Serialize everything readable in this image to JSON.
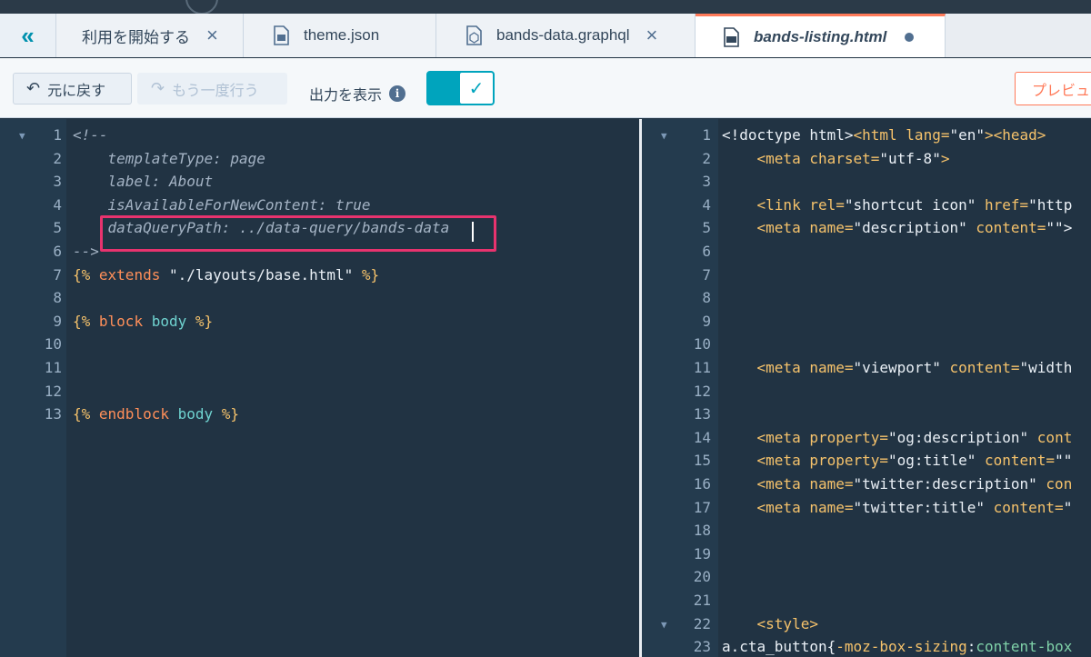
{
  "tabs": [
    {
      "label": "利用を開始する",
      "icon": "none",
      "closable": true
    },
    {
      "label": "theme.json",
      "icon": "json-file-icon",
      "closable": true
    },
    {
      "label": "bands-data.graphql",
      "icon": "graphql-file-icon",
      "closable": true
    },
    {
      "label": "bands-listing.html",
      "icon": "html-file-icon",
      "closable": false,
      "active": true,
      "unsaved": true
    }
  ],
  "toolbar": {
    "undo_label": "元に戻す",
    "redo_label": "もう一度行う",
    "output_label": "出力を表示",
    "output_toggle_on": true,
    "preview_label": "プレビュ"
  },
  "left_editor": {
    "lines": [
      {
        "n": "1",
        "fold": true,
        "parts": [
          [
            "c-com",
            "<!--"
          ]
        ]
      },
      {
        "n": "2",
        "parts": [
          [
            "c-com",
            "    templateType: page"
          ]
        ]
      },
      {
        "n": "3",
        "parts": [
          [
            "c-com",
            "    label: About"
          ]
        ]
      },
      {
        "n": "4",
        "parts": [
          [
            "c-com",
            "    isAvailableForNewContent: true"
          ]
        ]
      },
      {
        "n": "5",
        "parts": [
          [
            "c-com",
            "    dataQueryPath: ../data-query/bands-data"
          ]
        ]
      },
      {
        "n": "6",
        "parts": [
          [
            "c-com",
            "-->"
          ]
        ]
      },
      {
        "n": "7",
        "parts": [
          [
            "c-tpl",
            "{% "
          ],
          [
            "c-kw",
            "extends"
          ],
          [
            "c-str",
            " \"./layouts/base.html\" "
          ],
          [
            "c-tpl",
            "%}"
          ]
        ]
      },
      {
        "n": "8",
        "parts": []
      },
      {
        "n": "9",
        "parts": [
          [
            "c-tpl",
            "{% "
          ],
          [
            "c-kw",
            "block"
          ],
          [
            "c-id",
            " body "
          ],
          [
            "c-tpl",
            "%}"
          ]
        ]
      },
      {
        "n": "10",
        "parts": []
      },
      {
        "n": "11",
        "parts": []
      },
      {
        "n": "12",
        "parts": []
      },
      {
        "n": "13",
        "parts": [
          [
            "c-tpl",
            "{% "
          ],
          [
            "c-kw",
            "endblock"
          ],
          [
            "c-id",
            " body "
          ],
          [
            "c-tpl",
            "%}"
          ]
        ]
      }
    ]
  },
  "right_editor": {
    "lines": [
      {
        "n": "1",
        "fold": true,
        "parts": [
          [
            "c-white",
            "<!doctype html>"
          ],
          [
            "c-tag",
            "<html "
          ],
          [
            "c-attr",
            "lang="
          ],
          [
            "c-white",
            "\"en\""
          ],
          [
            "c-tag",
            "><head>"
          ]
        ]
      },
      {
        "n": "2",
        "parts": [
          [
            "c-tag",
            "    <meta "
          ],
          [
            "c-attr",
            "charset="
          ],
          [
            "c-white",
            "\"utf-8\""
          ],
          [
            "c-tag",
            ">"
          ]
        ]
      },
      {
        "n": "3",
        "parts": []
      },
      {
        "n": "4",
        "parts": [
          [
            "c-tag",
            "    <link "
          ],
          [
            "c-attr",
            "rel="
          ],
          [
            "c-white",
            "\"shortcut icon\" "
          ],
          [
            "c-attr",
            "href="
          ],
          [
            "c-white",
            "\"http"
          ]
        ]
      },
      {
        "n": "5",
        "parts": [
          [
            "c-tag",
            "    <meta "
          ],
          [
            "c-attr",
            "name="
          ],
          [
            "c-white",
            "\"description\" "
          ],
          [
            "c-attr",
            "content="
          ],
          [
            "c-white",
            "\"\">"
          ]
        ]
      },
      {
        "n": "6",
        "parts": []
      },
      {
        "n": "7",
        "parts": []
      },
      {
        "n": "8",
        "parts": []
      },
      {
        "n": "9",
        "parts": []
      },
      {
        "n": "10",
        "parts": []
      },
      {
        "n": "11",
        "parts": [
          [
            "c-tag",
            "    <meta "
          ],
          [
            "c-attr",
            "name="
          ],
          [
            "c-white",
            "\"viewport\" "
          ],
          [
            "c-attr",
            "content="
          ],
          [
            "c-white",
            "\"width"
          ]
        ]
      },
      {
        "n": "12",
        "parts": []
      },
      {
        "n": "13",
        "parts": []
      },
      {
        "n": "14",
        "parts": [
          [
            "c-tag",
            "    <meta "
          ],
          [
            "c-attr",
            "property="
          ],
          [
            "c-white",
            "\"og:description\" "
          ],
          [
            "c-attr",
            "cont"
          ]
        ]
      },
      {
        "n": "15",
        "parts": [
          [
            "c-tag",
            "    <meta "
          ],
          [
            "c-attr",
            "property="
          ],
          [
            "c-white",
            "\"og:title\" "
          ],
          [
            "c-attr",
            "content="
          ],
          [
            "c-white",
            "\"\""
          ]
        ]
      },
      {
        "n": "16",
        "parts": [
          [
            "c-tag",
            "    <meta "
          ],
          [
            "c-attr",
            "name="
          ],
          [
            "c-white",
            "\"twitter:description\" "
          ],
          [
            "c-attr",
            "con"
          ]
        ]
      },
      {
        "n": "17",
        "parts": [
          [
            "c-tag",
            "    <meta "
          ],
          [
            "c-attr",
            "name="
          ],
          [
            "c-white",
            "\"twitter:title\" "
          ],
          [
            "c-attr",
            "content="
          ],
          [
            "c-white",
            "\""
          ]
        ]
      },
      {
        "n": "18",
        "parts": []
      },
      {
        "n": "19",
        "parts": []
      },
      {
        "n": "20",
        "parts": []
      },
      {
        "n": "21",
        "parts": []
      },
      {
        "n": "22",
        "fold": true,
        "parts": [
          [
            "c-tag",
            "    <style>"
          ]
        ]
      },
      {
        "n": "23",
        "parts": [
          [
            "c-white",
            "a.cta_button{"
          ],
          [
            "c-attr",
            "-moz-box-sizing"
          ],
          [
            "c-white",
            ":"
          ],
          [
            "c-green",
            "content-box"
          ]
        ]
      }
    ]
  }
}
